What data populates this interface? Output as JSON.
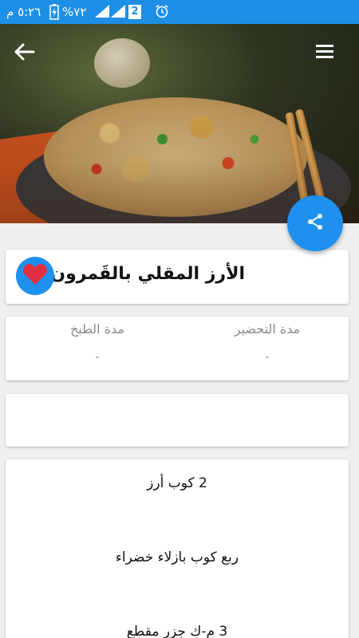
{
  "status_bar": {
    "time": "٥:٢٦ م",
    "battery": "%٧٢",
    "sim_badge": "2"
  },
  "recipe": {
    "title": "الأرز المقلي بالقَمرون",
    "prep_time_label": "مدة التحضير",
    "prep_time_value": "-",
    "cook_time_label": "مدة الطبخ",
    "cook_time_value": "-",
    "description": "",
    "ingredients": [
      "2 كوب أرز",
      "ربع كوب بازلاء خضراء",
      "3 م-ك جزر مقطع"
    ]
  },
  "icons": {
    "back": "arrow-back-icon",
    "menu": "menu-icon",
    "share": "share-icon",
    "favorite": "heart-icon"
  },
  "colors": {
    "accent": "#1e90ee",
    "status_bar": "#1e8fe6",
    "heart": "#e0303f",
    "background": "#efefef"
  }
}
